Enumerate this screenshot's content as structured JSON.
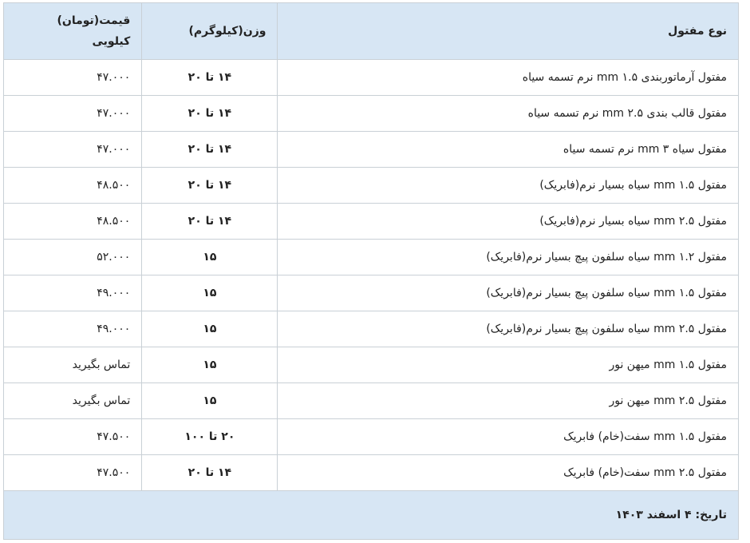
{
  "header": {
    "type": "نوع مفتول",
    "weight": "وزن(کیلوگرم)",
    "price_line1": "قیمت(تومان)",
    "price_line2": "کیلویی"
  },
  "rows": [
    {
      "type": "مفتول آرماتوربندی ۱.۵ mm نرم تسمه سیاه",
      "weight": "۱۴ تا ۲۰",
      "price": "۴۷.۰۰۰"
    },
    {
      "type": "مفتول قالب بندی ۲.۵ mm نرم تسمه سیاه",
      "weight": "۱۴ تا ۲۰",
      "price": "۴۷.۰۰۰"
    },
    {
      "type": "مفتول سیاه ۳ mm نرم تسمه سیاه",
      "weight": "۱۴ تا ۲۰",
      "price": "۴۷.۰۰۰"
    },
    {
      "type": "مفتول ۱.۵ mm سیاه بسیار نرم(فابریک)",
      "weight": "۱۴ تا ۲۰",
      "price": "۴۸.۵۰۰"
    },
    {
      "type": "مفتول ۲.۵ mm سیاه بسیار نرم(فابریک)",
      "weight": "۱۴ تا ۲۰",
      "price": "۴۸.۵۰۰"
    },
    {
      "type": "مفتول ۱.۲ mm سیاه سلفون پیچ بسیار نرم(فابریک)",
      "weight": "۱۵",
      "price": "۵۲.۰۰۰"
    },
    {
      "type": "مفتول ۱.۵ mm سیاه سلفون پیچ بسیار نرم(فابریک)",
      "weight": "۱۵",
      "price": "۴۹.۰۰۰"
    },
    {
      "type": "مفتول ۲.۵ mm سیاه سلفون پیچ بسیار نرم(فابریک)",
      "weight": "۱۵",
      "price": "۴۹.۰۰۰"
    },
    {
      "type": "مفتول ۱.۵ mm میهن نور",
      "weight": "۱۵",
      "price": "تماس بگیرید"
    },
    {
      "type": "مفتول ۲.۵ mm میهن نور",
      "weight": "۱۵",
      "price": "تماس بگیرید"
    },
    {
      "type": "مفتول ۱.۵ mm سفت(خام) فابریک",
      "weight": "۲۰ تا ۱۰۰",
      "price": "۴۷.۵۰۰"
    },
    {
      "type": "مفتول ۲.۵ mm سفت(خام) فابریک",
      "weight": "۱۴ تا ۲۰",
      "price": "۴۷.۵۰۰"
    }
  ],
  "footer": {
    "date": "تاریخ: ۴ اسفند ۱۴۰۳"
  },
  "colors": {
    "header_bg": "#d7e6f4",
    "border": "#c9d0d6"
  }
}
